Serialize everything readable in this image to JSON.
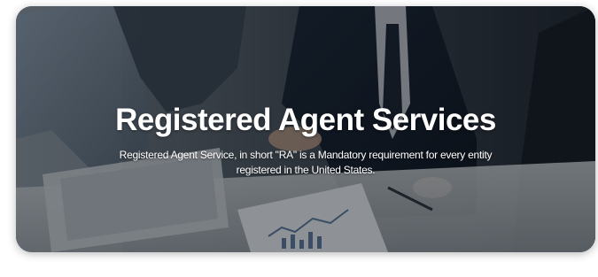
{
  "hero": {
    "title": "Registered Agent Services",
    "description": "Registered Agent Service, in short \"RA\" is a Mandatory requirement for every entity registered in the United States."
  },
  "colors": {
    "overlay": "#0e141a",
    "text": "#ffffff"
  }
}
